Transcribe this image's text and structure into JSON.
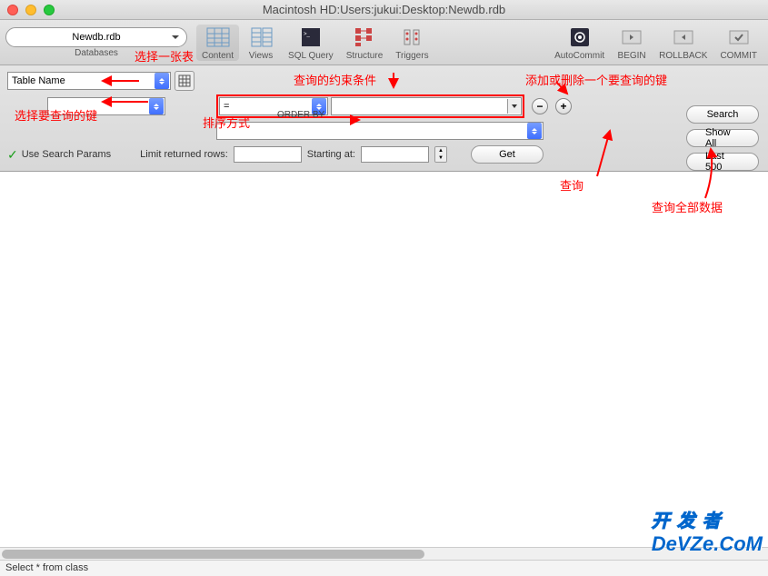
{
  "window": {
    "title": "Macintosh HD:Users:jukui:Desktop:Newdb.rdb"
  },
  "toolbar": {
    "database_dropdown": "Newdb.rdb",
    "database_label": "Databases",
    "items": [
      {
        "label": "Content"
      },
      {
        "label": "Views"
      },
      {
        "label": "SQL Query"
      },
      {
        "label": "Structure"
      },
      {
        "label": "Triggers"
      }
    ],
    "right_items": [
      {
        "label": "AutoCommit"
      },
      {
        "label": "BEGIN"
      },
      {
        "label": "ROLLBACK"
      },
      {
        "label": "COMMIT"
      }
    ]
  },
  "filters": {
    "table_name_placeholder": "Table Name",
    "operator": "=",
    "value": "",
    "order_by_label": "ORDER BY",
    "use_search_params": "Use Search Params",
    "limit_label": "Limit returned rows:",
    "limit_value": "",
    "starting_label": "Starting at:",
    "starting_value": "",
    "get_button": "Get",
    "search_button": "Search",
    "show_all_button": "Show All",
    "last_button": "Last 500"
  },
  "annotations": {
    "select_table": "选择一张表",
    "query_condition": "查询的约束条件",
    "add_remove_key": "添加或删除一个要查询的键",
    "select_key": "选择要查询的键",
    "sort_method": "排序方式",
    "query": "查询",
    "query_all": "查询全部数据"
  },
  "watermark": {
    "line1": "开发者",
    "line2": "DeVZe.CoM"
  },
  "footer": {
    "status": "Select * from class"
  }
}
